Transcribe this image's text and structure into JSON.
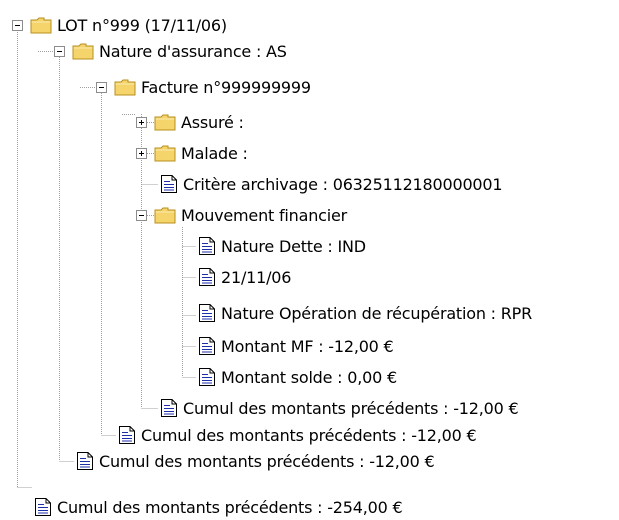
{
  "tree": {
    "lot": "LOT n°999 (17/11/06)",
    "nature_assurance": "Nature d'assurance : AS",
    "facture": "Facture n°999999999",
    "assure": "Assuré :",
    "malade": "Malade :",
    "critere": "Critère archivage : 06325112180000001",
    "mouvement": "Mouvement financier",
    "nature_dette": "Nature Dette : IND",
    "date": "21/11/06",
    "nature_operation": "Nature Opération de récupération : RPR",
    "montant_mf": "Montant MF : -12,00 €",
    "montant_solde": "Montant solde : 0,00 €",
    "cumul_facture": "Cumul des montants précédents : -12,00 €",
    "cumul_nature": "Cumul des montants précédents : -12,00 €",
    "cumul_lot": "Cumul des montants précédents : -12,00 €",
    "cumul_root": "Cumul des montants précédents : -254,00 €"
  },
  "icons": {
    "folder": "folder-icon",
    "document": "document-icon",
    "expand": "plus-toggle-icon",
    "collapse": "minus-toggle-icon"
  },
  "colors": {
    "folder_fill": "#f4d46b",
    "folder_border": "#b8901c",
    "guide_dots": "#a0a0a0"
  }
}
